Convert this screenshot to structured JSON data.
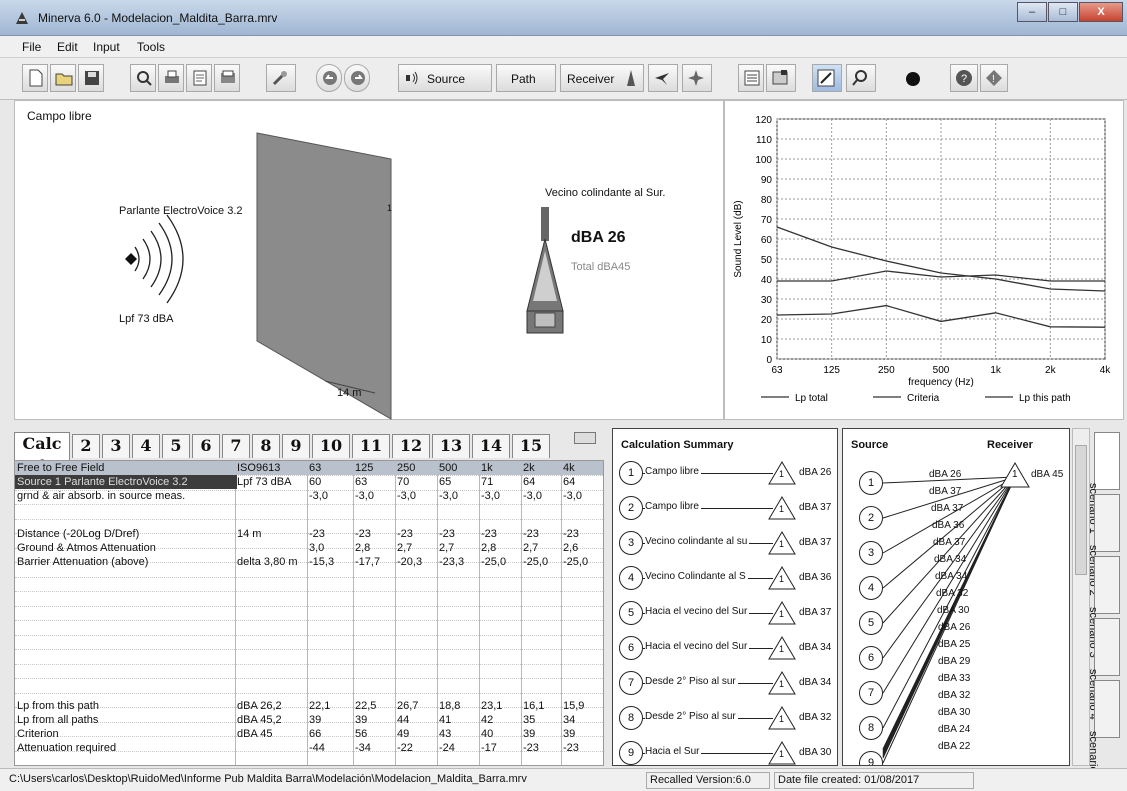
{
  "window": {
    "title": "Minerva 6.0 - Modelacion_Maldita_Barra.mrv",
    "min_label": "–",
    "max_label": "□",
    "close_label": "X"
  },
  "menu": [
    "File",
    "Edit",
    "Input",
    "Tools"
  ],
  "toolbar": {
    "source": "Source",
    "path": "Path",
    "receiver": "Receiver"
  },
  "scene": {
    "label": "Campo libre",
    "source_name": "Parlante ElectroVoice 3.2",
    "source_level": "Lpf 73 dBA",
    "distance": "14 m",
    "receiver_name": "Vecino colindante al Sur.",
    "receiver_dba": "dBA 26",
    "receiver_total": "Total dBA45",
    "barrier_mark": "1"
  },
  "chart_data": {
    "type": "line",
    "categories": [
      "63",
      "125",
      "250",
      "500",
      "1k",
      "2k",
      "4k"
    ],
    "ylabel": "Sound Level (dB)",
    "xlabel": "frequency (Hz)",
    "ylim": [
      0,
      120
    ],
    "yticks": [
      0,
      10,
      20,
      30,
      40,
      50,
      60,
      70,
      80,
      90,
      100,
      110,
      120
    ],
    "series": [
      {
        "name": "Lp total",
        "values": [
          66,
          56,
          49,
          43,
          40,
          35,
          34
        ]
      },
      {
        "name": "Criteria",
        "values": [
          39,
          39,
          44,
          41,
          42,
          39,
          39
        ]
      },
      {
        "name": "Lp this path",
        "values": [
          22,
          22.5,
          26.7,
          18.8,
          23.1,
          16.1,
          15.9
        ]
      }
    ]
  },
  "calc_tabs": [
    "Calc 1",
    "2",
    "3",
    "4",
    "5",
    "6",
    "7",
    "8",
    "9",
    "10",
    "11",
    "12",
    "13",
    "14",
    "15"
  ],
  "grid": {
    "header": [
      "Free to Free Field",
      "ISO9613",
      "63",
      "125",
      "250",
      "500",
      "1k",
      "2k",
      "4k"
    ],
    "rows": [
      [
        "Source 1   Parlante ElectroVoice 3.2",
        "Lpf 73 dBA",
        "60",
        "63",
        "70",
        "65",
        "71",
        "64",
        "64"
      ],
      [
        "grnd & air absorb. in source meas.",
        "",
        "-3,0",
        "-3,0",
        "-3,0",
        "-3,0",
        "-3,0",
        "-3,0",
        "-3,0"
      ],
      [
        "",
        "",
        "",
        "",
        "",
        "",
        "",
        "",
        ""
      ],
      [
        "Distance (-20Log D/Dref)",
        "14 m",
        "-23",
        "-23",
        "-23",
        "-23",
        "-23",
        "-23",
        "-23"
      ],
      [
        "Ground & Atmos Attenuation",
        "",
        "3,0",
        "2,8",
        "2,7",
        "2,7",
        "2,8",
        "2,7",
        "2,6"
      ],
      [
        "Barrier Attenuation (above)",
        "delta 3,80 m",
        "-15,3",
        "-17,7",
        "-20,3",
        "-23,3",
        "-25,0",
        "-25,0",
        "-25,0"
      ]
    ],
    "footer_rows": [
      [
        "Lp from this path",
        "dBA 26,2",
        "22,1",
        "22,5",
        "26,7",
        "18,8",
        "23,1",
        "16,1",
        "15,9"
      ],
      [
        "Lp from all paths",
        "dBA 45,2",
        "39",
        "39",
        "44",
        "41",
        "42",
        "35",
        "34"
      ],
      [
        "Criterion",
        "dBA 45",
        "66",
        "56",
        "49",
        "43",
        "40",
        "39",
        "39"
      ],
      [
        "Attenuation required",
        "",
        "-44",
        "-34",
        "-22",
        "-24",
        "-17",
        "-23",
        "-23"
      ]
    ]
  },
  "summary": {
    "title": "Calculation Summary",
    "items": [
      {
        "num": "1",
        "name": "Campo libre",
        "rec": "1",
        "dba": "dBA 26"
      },
      {
        "num": "2",
        "name": "Campo libre",
        "rec": "1",
        "dba": "dBA 37"
      },
      {
        "num": "3",
        "name": "Vecino colindante al su",
        "rec": "1",
        "dba": "dBA 37"
      },
      {
        "num": "4",
        "name": "Vecino Colindante al S",
        "rec": "1",
        "dba": "dBA 36"
      },
      {
        "num": "5",
        "name": "Hacia el vecino del Sur",
        "rec": "1",
        "dba": "dBA 37"
      },
      {
        "num": "6",
        "name": "Hacia el vecino del Sur",
        "rec": "1",
        "dba": "dBA 34"
      },
      {
        "num": "7",
        "name": "Desde 2° Piso al sur",
        "rec": "1",
        "dba": "dBA 34"
      },
      {
        "num": "8",
        "name": "Desde 2° Piso al sur",
        "rec": "1",
        "dba": "dBA 32"
      },
      {
        "num": "9",
        "name": "Hacia el Sur",
        "rec": "1",
        "dba": "dBA 30"
      }
    ]
  },
  "source_receiver": {
    "source_label": "Source",
    "receiver_label": "Receiver",
    "receiver_num": "1",
    "receiver_dba": "dBA 45",
    "sources": [
      "1",
      "2",
      "3",
      "4",
      "5",
      "6",
      "7",
      "8",
      "9"
    ],
    "path_labels": [
      "dBA 26",
      "dBA 37",
      "dBA 37",
      "dBA 36",
      "dBA 37",
      "dBA 34",
      "dBA 34",
      "dBA 32",
      "dBA 30",
      "dBA 26",
      "dBA 25",
      "dBA 29",
      "dBA 33",
      "dBA 32",
      "dBA 30",
      "dBA 24",
      "dBA 22"
    ]
  },
  "scenarios": [
    "scenario 1",
    "scenario 2",
    "scenario 3",
    "scenario 4",
    "scenario 5"
  ],
  "status": {
    "path": "C:\\Users\\carlos\\Desktop\\RuidoMed\\Informe Pub Maldita Barra\\Modelación\\Modelacion_Maldita_Barra.mrv",
    "version": "Recalled Version:6.0",
    "date": "Date file created: 01/08/2017"
  },
  "colors": {
    "grid_header": "#b9c2cc",
    "selected_row": "#3c3c3c",
    "barrier": "#8b8b8b"
  }
}
